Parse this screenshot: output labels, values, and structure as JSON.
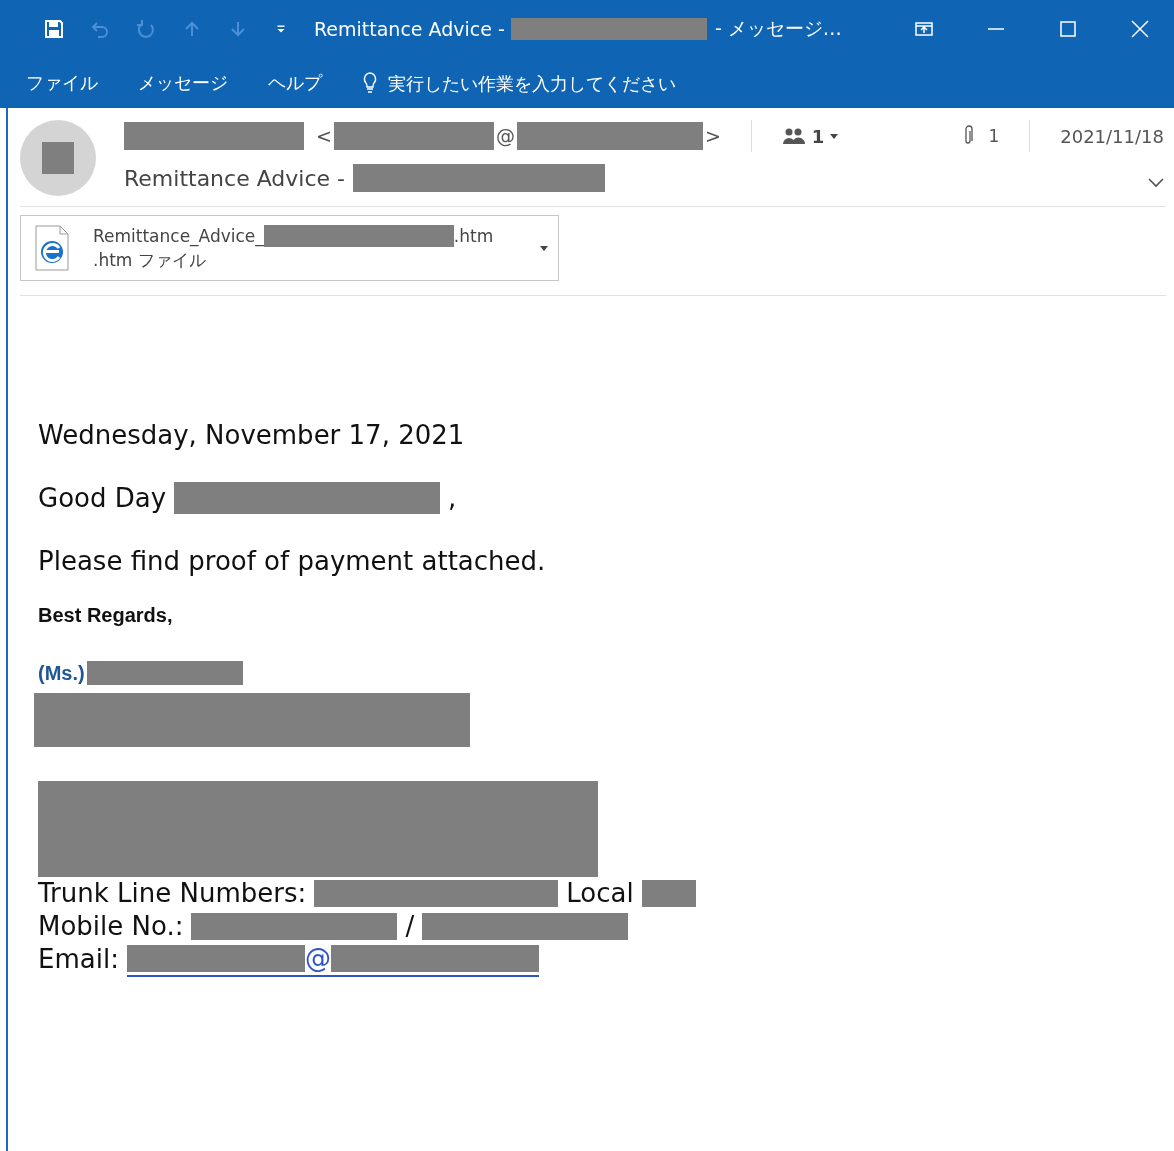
{
  "window": {
    "title": "Remittance Advice -",
    "title_suffix": "- メッセージ…"
  },
  "menu": [
    {
      "label": "ファイル"
    },
    {
      "label": "メッセージ"
    },
    {
      "label": "ヘルプ"
    }
  ],
  "tell_me": {
    "placeholder": "実行したい作業を入力してください"
  },
  "header": {
    "sender_open": "<",
    "sender_at": "@",
    "sender_close": ">",
    "people_count": "1",
    "attachment_count": "1",
    "date": "2021/11/18",
    "subject": "Remittance Advice -"
  },
  "attachment": {
    "name_prefix": "Remittance_Advice_",
    "name_suffix": ".htm",
    "type": ".htm ファイル"
  },
  "body": {
    "date": "Wednesday, November 17, 2021",
    "greeting": "Good Day",
    "greeting_end": ",",
    "message": "Please find proof of payment attached.",
    "closing": "Best Regards,",
    "title": "(Ms.)",
    "trunk_label": "Trunk Line Numbers:",
    "local_label": "Local",
    "mobile_label": "Mobile No.:",
    "mobile_sep": "/",
    "email_label": "Email:",
    "email_at": "@"
  }
}
